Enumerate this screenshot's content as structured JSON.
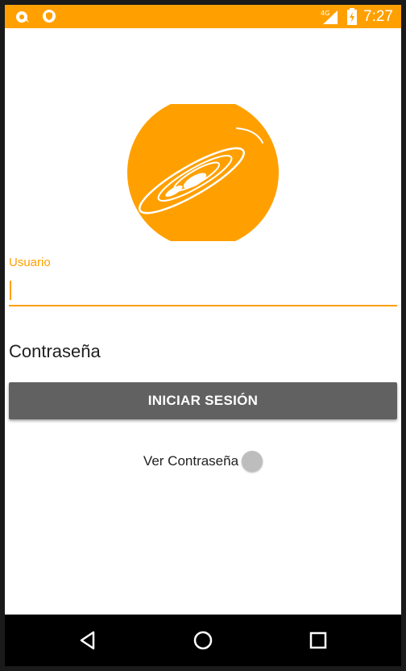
{
  "status_bar": {
    "time": "7:27",
    "network": "4G",
    "icons": [
      "notification-app-icon",
      "vpn-shield-icon",
      "signal-icon",
      "battery-charging-icon"
    ]
  },
  "colors": {
    "accent": "#FFA000",
    "button": "#616161",
    "nav_bar": "#000000"
  },
  "logo": {
    "icon": "planet-logo-icon"
  },
  "form": {
    "username_label": "Usuario",
    "username_value": "",
    "password_placeholder": "Contraseña",
    "login_button": "INICIAR SESIÓN",
    "show_password_label": "Ver Contraseña",
    "show_password_on": false
  },
  "navigation": {
    "back": "back-icon",
    "home": "home-icon",
    "recents": "recents-icon"
  }
}
